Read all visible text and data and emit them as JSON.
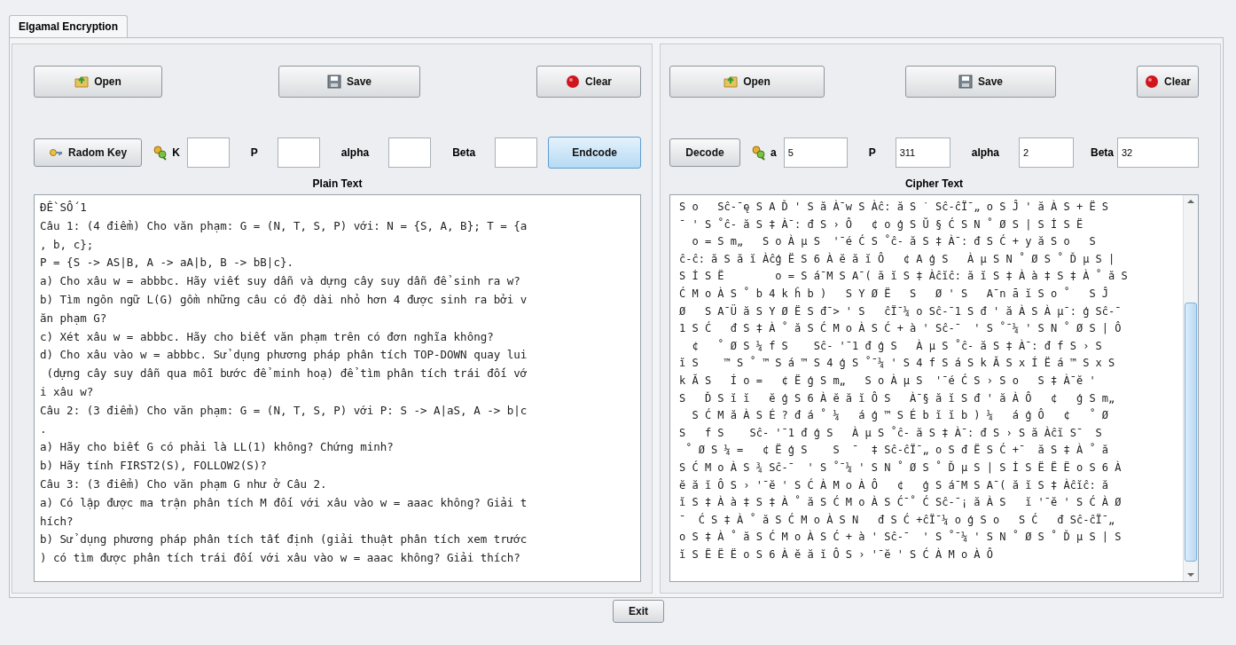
{
  "tabs": [
    {
      "label": "Elgamal Encryption",
      "selected": true
    }
  ],
  "panels": [
    {
      "toolbar": [
        {
          "label": "Open",
          "kind": "open"
        },
        {
          "label": "Save",
          "kind": "save"
        },
        {
          "label": "Clear",
          "kind": "clear"
        }
      ],
      "action_button": {
        "label": "Radom Key",
        "kind": "random",
        "focused": false
      },
      "fields": [
        {
          "label": "K",
          "kind": "key"
        },
        {
          "label": "P",
          "kind": "plain"
        },
        {
          "label": "alpha",
          "kind": "plain"
        },
        {
          "label": "Beta",
          "kind": "plain"
        }
      ],
      "trailing_button": {
        "label": "Endcode",
        "focused": true
      },
      "text_title": "Plain Text",
      "scrollbar": false,
      "lines": [
        "ĐỀ SỐ 1",
        "Câu 1: (4 điểm) Cho văn phạm: G = (N, T, S, P) với: N = {S, A, B}; T = {a",
        ", b, c};",
        "P = {S -> AS|B, A -> aA|b, B -> bB|c}.",
        "a) Cho xâu w = abbbc. Hãy viết suy dẫn và dựng cây suy dẫn để sinh ra w?",
        "b) Tìm ngôn ngữ L(G) gồm những câu có độ dài nhỏ hơn 4 được sinh ra bởi v",
        "ăn phạm G?",
        "c) Xét xâu w = abbbc. Hãy cho biết văn phạm trên có đơn nghĩa không?",
        "d) Cho xâu vào w = abbbc. Sử dụng phương pháp phân tích TOP-DOWN quay lui",
        " (dựng cây suy dẫn qua mỗi bước để minh hoạ) để tìm phân tích trái đối vớ",
        "i xâu w?",
        "Câu 2: (3 điểm) Cho văn phạm: G = (N, T, S, P) với P: S -> A|aS, A -> b|c",
        ".",
        "a) Hãy cho biết G có phải là LL(1) không? Chứng minh?",
        "b) Hãy tính FIRST2(S), FOLLOW2(S)?",
        "Câu 3: (3 điểm) Cho văn phạm G như ở Câu 2.",
        "a) Có lập được ma trận phân tích M đối với xâu vào w = aaac không? Giải t",
        "hích?",
        "b) Sử dụng phương pháp phân tích tất định (giải thuật phân tích xem trước",
        ") có tìm được phân tích trái đối với xâu vào w = aaac không? Giải thích?"
      ]
    },
    {
      "toolbar": [
        {
          "label": "Open",
          "kind": "open"
        },
        {
          "label": "Save",
          "kind": "save"
        },
        {
          "label": "Clear",
          "kind": "clear"
        }
      ],
      "action_button": {
        "label": "Decode",
        "kind": "plain",
        "focused": false
      },
      "fields": [
        {
          "label": "a",
          "kind": "key",
          "value": "5"
        },
        {
          "label": "P",
          "kind": "plain",
          "value": "311"
        },
        {
          "label": "alpha",
          "kind": "plain",
          "value": "2"
        },
        {
          "label": "Beta",
          "kind": "inline",
          "value": "32"
        }
      ],
      "text_title": "Cipher Text",
      "scrollbar": true,
      "lines": [
        "S o   Sĉ-¯ę S A Ď ' S ă À¯w S Àĉ: ă S ˙ Sĉ-ĉÏ¯„ o S Ĵ ' ă À S + Ë S",
        "¯ ' S ˚ĉ- ă S ‡ À¯: đ S › Ô   ¢ o ģ S Ŭ § Ć S N ˚ Ø S | S İ S Ë",
        "  o = S m„   S o À µ S  '¯é Ć S ˚ĉ- ă S ‡ À¯: đ S Ć + y ă S o   S",
        "ĉ-ĉ: ă S ă ĭ Àĉģ Ë S 6 À ĕ ă ĭ Ô   ¢ A ģ S   À µ S N ˚ Ø S ˚ Ď µ S |",
        "S İ S Ë        o = S á¯M S A¯( ă ĭ S ‡ Àĉĭĉ: ă ĭ S ‡ À à ‡ S ‡ À ˚ ă S",
        "Ć M o À S ˚ b 4 k ĥ b )   S Y Ø Ë   S   Ø ' S   A¯n ā ĭ S o ˚   S Ĵ",
        "Ø   S A¯Ü ă S Y Ø Ë S đ¯> ' S   ĉÏ¯¼ o Sĉ-¯1 S đ ' ă À S À µ¯: ģ Sĉ-¯",
        "1 S Ć   đ S ‡ À ˚ ă S Ć M o À S Ć + à ' Sĉ-¯  ' S ˚¯¼ ' S N ˚ Ø S | Ô",
        "  ¢   ˚ Ø S ¼ f S    Sĉ- '¯1 đ ģ S   À µ S ˚ĉ- ă S ‡ À¯: đ f S › S",
        "ĭ S    ™ S ˚ ™ S á ™ S 4 ģ S ˚¯¼ ' S 4 f S á S k Ă S x Í Ë á ™ S x S",
        "k Ă S   Í o =   ¢ Ë ģ S m„   S o À µ S  '¯é Ć S › S o   S ‡ À¯ĕ '",
        "S   Ď S ĭ ĭ   ĕ ģ S 6 À ĕ ă ĭ Ô S   À¯§ ă ĭ S đ ' ă À Ô   ¢   ģ S m„",
        "  S Ć M ă À S É ? đ á ˚ ¼   á ģ ™ S É b ĭ ĭ b ) ¼   á ģ Ô   ¢   ˚ Ø",
        "S   f S    Sĉ- '¯1 đ ģ S   À µ S ˚ĉ- ă S ‡ À¯: đ S › S ă Àĉĭ S¯  S",
        " ˚ Ø S ¼ =   ¢ Ë ģ S    S  ¯  ‡ Sĉ-ĉÏ¯„ o S đ Ë S Ć +¯  ă S ‡ À ˚ ă",
        "S Ć M o À S ¾ Sĉ-¯  ' S ˚¯¼ ' S N ˚ Ø S ˚ Ď µ S | S İ S Ë Ë Ë o S 6 À",
        "ĕ ă ĭ Ô S › '¯ĕ ' S Ć À M o À Ô   ¢   ģ S á¯M S A¯( ă ĭ S ‡ Àĉĭĉ: ă",
        "ĭ S ‡ À à ‡ S ‡ À ˚ ă S Ć M o À S Ć¯˚ Ć Sĉ-¯¡ ă À S   ĭ '¯ĕ ' S Ć À Ø",
        "¯  Ć S ‡ À ˚ ă S Ć M o À S N   đ S Ć +ĉÏ¯¼ o ģ S o   S Ć   đ Sĉ-ĉÏ¯„",
        "o S ‡ À ˚ ă S Ć M o À S Ć + à ' Sĉ-¯  ' S ˚¯¼ ' S N ˚ Ø S ˚ Ď µ S | S",
        "ĭ S Ë Ë Ë o S 6 À ĕ ă ĭ Ô S › '¯ĕ ' S Ć À M o À Ô"
      ]
    }
  ],
  "exit_button": "Exit"
}
